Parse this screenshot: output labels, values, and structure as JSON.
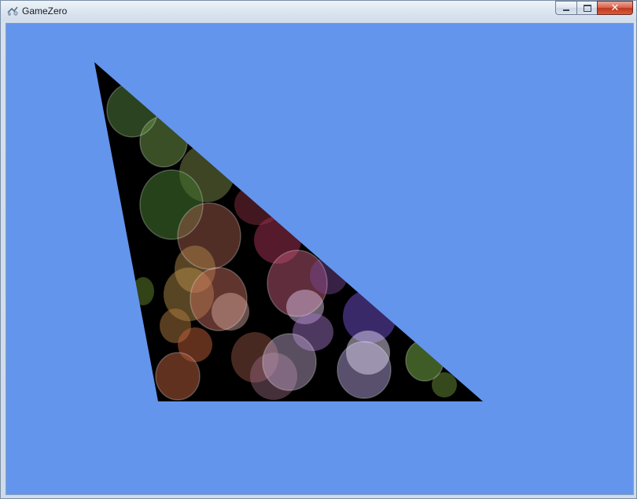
{
  "window": {
    "title": "GameZero",
    "icon": "gamezero-app-icon",
    "buttons": {
      "minimize_icon": "minimize-icon",
      "maximize_icon": "maximize-icon",
      "close_icon": "close-icon",
      "close_glyph": "✕"
    }
  },
  "scene": {
    "background_color": "#6495ed",
    "shape": "triangle",
    "texture": "bokeh-lights",
    "texture_base_color": "#000000",
    "accent_colors": [
      "#5f8f3a",
      "#b64a4a",
      "#8a3b6a",
      "#7a5cc0",
      "#c9a24a",
      "#e0d0e8",
      "#6fa04a"
    ]
  }
}
